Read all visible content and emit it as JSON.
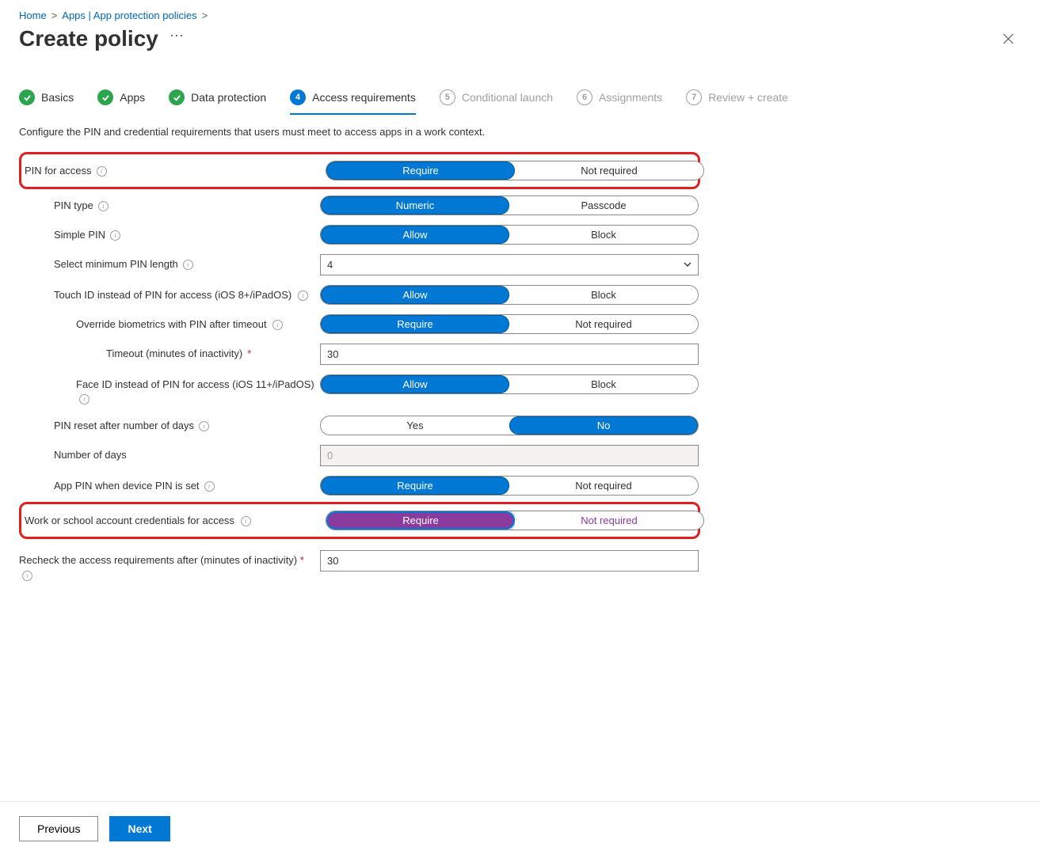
{
  "breadcrumb": {
    "home": "Home",
    "apps": "Apps | App protection policies"
  },
  "page": {
    "title": "Create policy",
    "description": "Configure the PIN and credential requirements that users must meet to access apps in a work context."
  },
  "steps": [
    {
      "label": "Basics"
    },
    {
      "label": "Apps"
    },
    {
      "label": "Data protection"
    },
    {
      "num": "4",
      "label": "Access requirements"
    },
    {
      "num": "5",
      "label": "Conditional launch"
    },
    {
      "num": "6",
      "label": "Assignments"
    },
    {
      "num": "7",
      "label": "Review + create"
    }
  ],
  "fields": {
    "pin_access": {
      "label": "PIN for access",
      "opt_a": "Require",
      "opt_b": "Not required"
    },
    "pin_type": {
      "label": "PIN type",
      "opt_a": "Numeric",
      "opt_b": "Passcode"
    },
    "simple_pin": {
      "label": "Simple PIN",
      "opt_a": "Allow",
      "opt_b": "Block"
    },
    "min_pin_len": {
      "label": "Select minimum PIN length",
      "value": "4"
    },
    "touchid": {
      "label": "Touch ID instead of PIN for access (iOS 8+/iPadOS)",
      "opt_a": "Allow",
      "opt_b": "Block"
    },
    "override_bio": {
      "label": "Override biometrics with PIN after timeout",
      "opt_a": "Require",
      "opt_b": "Not required"
    },
    "timeout_inactivity": {
      "label": "Timeout (minutes of inactivity)",
      "value": "30"
    },
    "faceid": {
      "label": "Face ID instead of PIN for access (iOS 11+/iPadOS)",
      "opt_a": "Allow",
      "opt_b": "Block"
    },
    "pin_reset_days": {
      "label": "PIN reset after number of days",
      "opt_a": "Yes",
      "opt_b": "No"
    },
    "num_days": {
      "label": "Number of days",
      "value": "0"
    },
    "app_pin_device": {
      "label": "App PIN when device PIN is set",
      "opt_a": "Require",
      "opt_b": "Not required"
    },
    "work_school": {
      "label": "Work or school account credentials for access",
      "opt_a": "Require",
      "opt_b": "Not required"
    },
    "recheck": {
      "label": "Recheck the access requirements after (minutes of inactivity)",
      "value": "30"
    }
  },
  "footer": {
    "previous": "Previous",
    "next": "Next"
  }
}
